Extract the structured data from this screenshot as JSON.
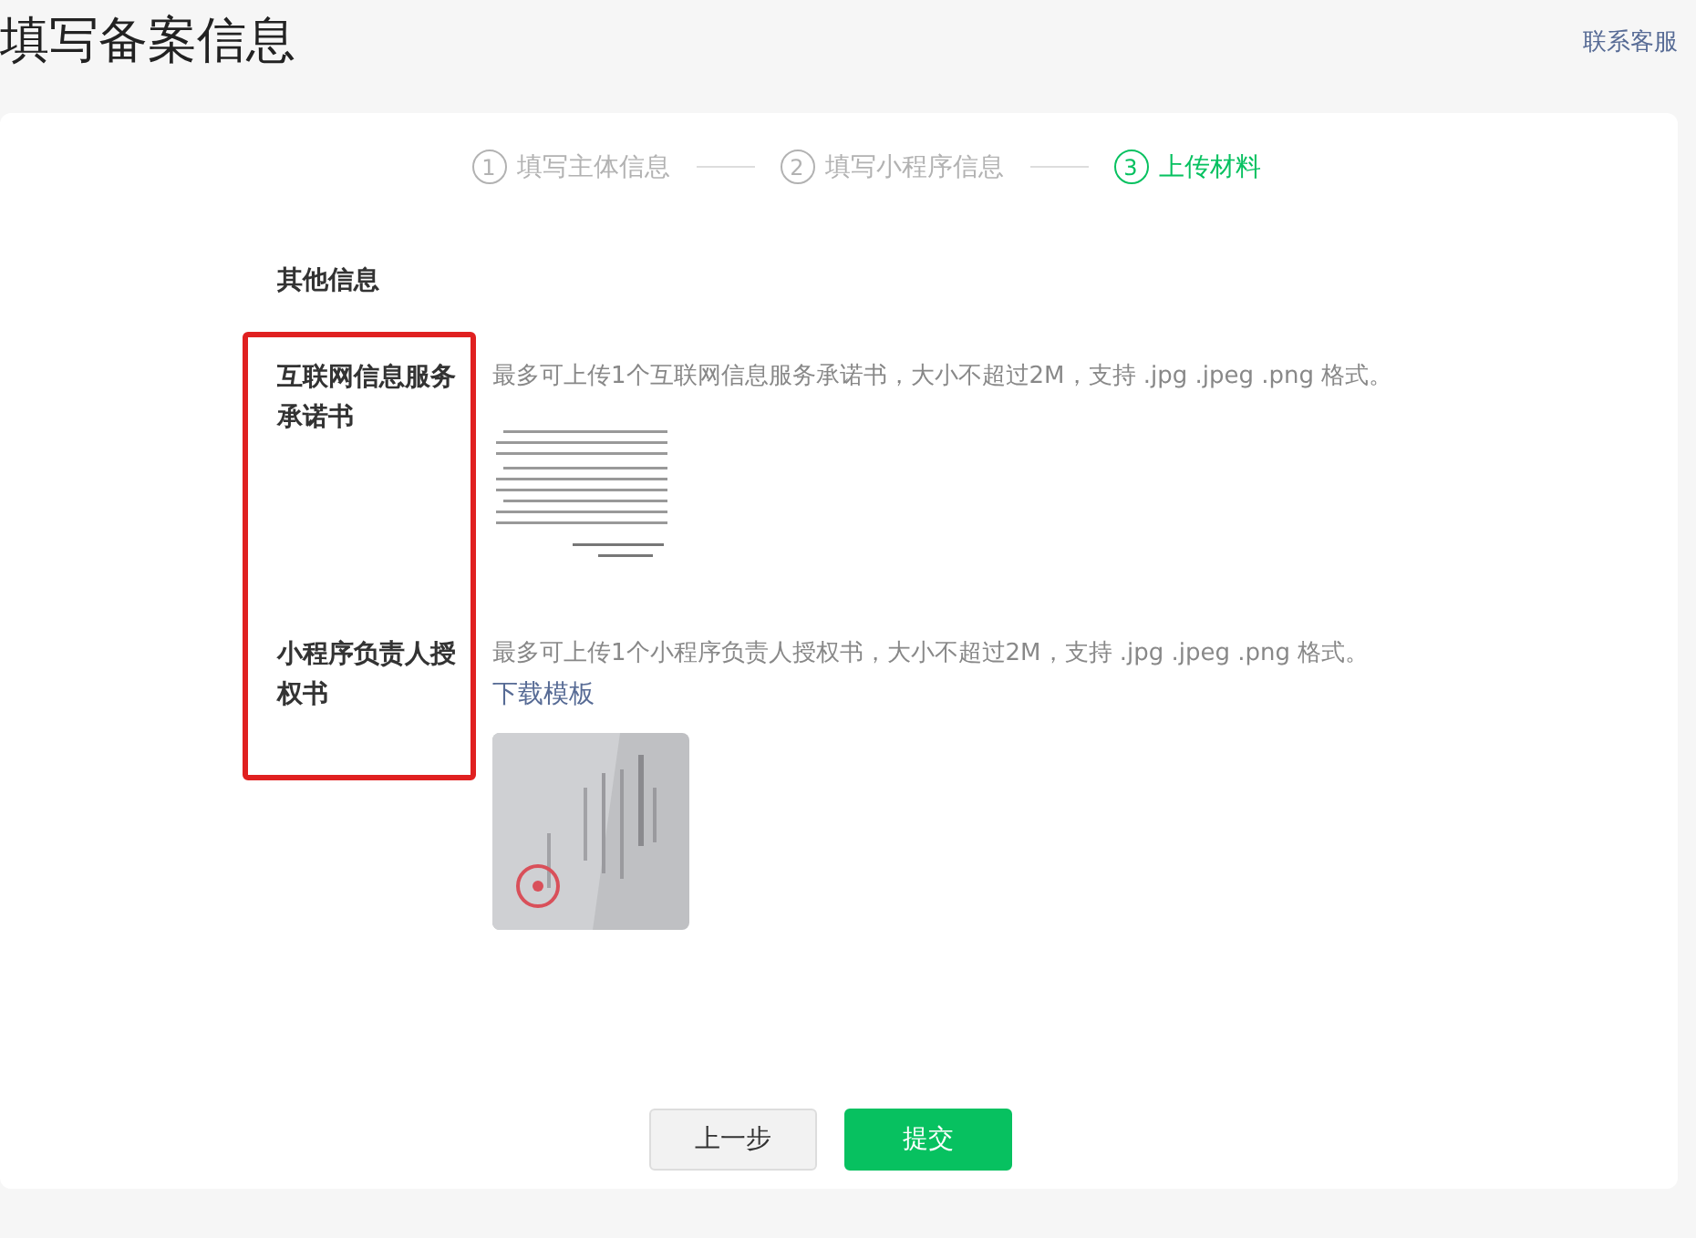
{
  "page_title": "填写备案信息",
  "support_link": "联系客服",
  "steps": [
    {
      "number": "1",
      "label": "填写主体信息",
      "selected": false
    },
    {
      "number": "2",
      "label": "填写小程序信息",
      "selected": false
    },
    {
      "number": "3",
      "label": "上传材料",
      "selected": true
    }
  ],
  "section_title": "其他信息",
  "fields": [
    {
      "label": "互联网信息服务承诺书",
      "hint": "最多可上传1个互联网信息服务承诺书，大小不超过2M，支持 .jpg .jpeg .png 格式。",
      "uploaded": {
        "kind": "document"
      }
    },
    {
      "label": "小程序负责人授权书",
      "hint": "最多可上传1个小程序负责人授权书，大小不超过2M，支持 .jpg .jpeg .png 格式。",
      "link": "下载模板"
    }
  ],
  "buttons": [
    {
      "label": "上一步",
      "kind": "secondary"
    },
    {
      "label": "提交",
      "kind": "primary"
    }
  ]
}
